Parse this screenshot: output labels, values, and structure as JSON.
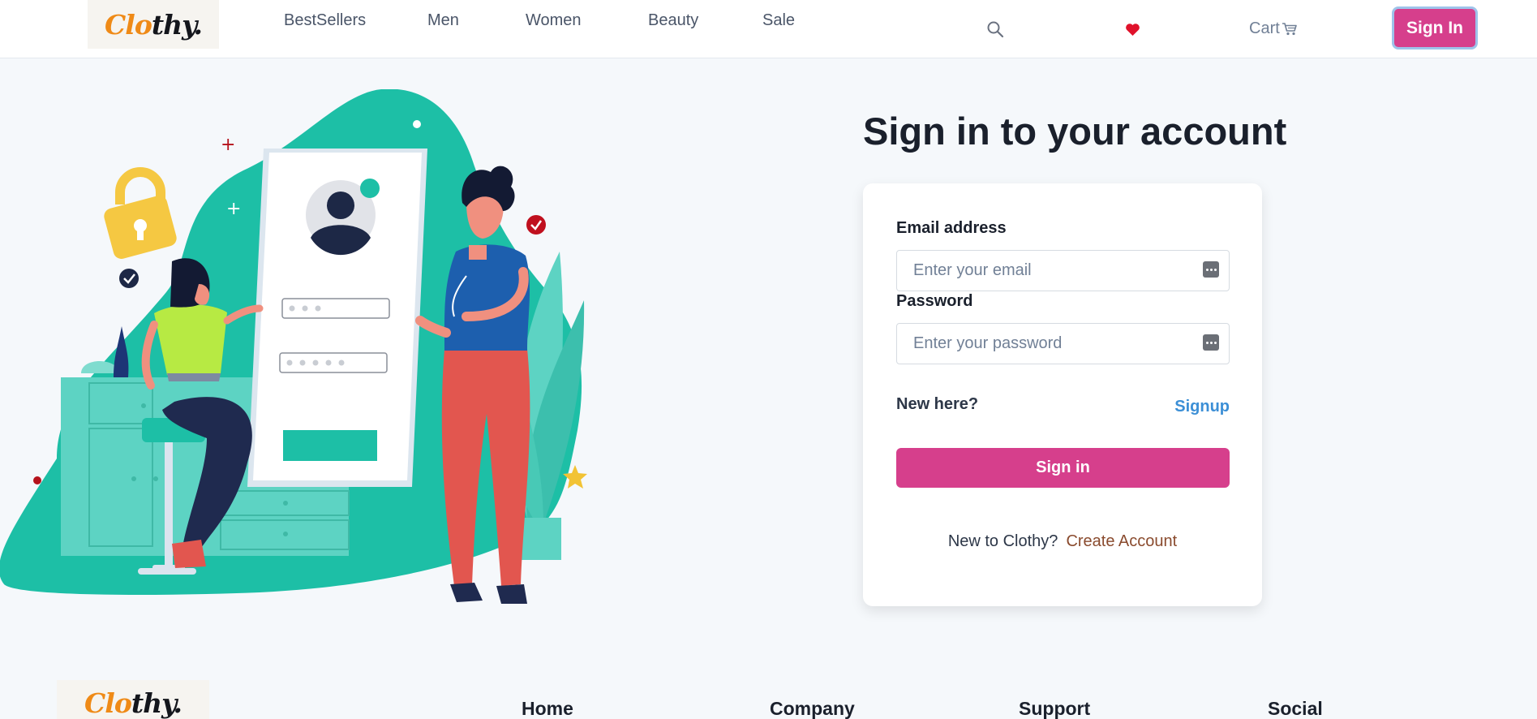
{
  "nav": {
    "logo_part1": "Clo",
    "logo_part2": "thy.",
    "links": [
      "BestSellers",
      "Men",
      "Women",
      "Beauty",
      "Sale"
    ],
    "cart_label": "Cart",
    "signin_label": "Sign In",
    "icons": {
      "search": "search-icon",
      "favorites": "heart-icon",
      "cart": "cart-icon"
    }
  },
  "form": {
    "heading": "Sign in to your account",
    "email_label": "Email address",
    "email_placeholder": "Enter your email",
    "password_label": "Password",
    "password_placeholder": "Enter your password",
    "new_here_text": "New here?",
    "signup_link": "Signup",
    "signin_button": "Sign in",
    "new_to_text": "New to Clothy?",
    "create_account_link": "Create Account"
  },
  "footer": {
    "logo_part1": "Clo",
    "logo_part2": "thy.",
    "columns": [
      "Home",
      "Company",
      "Support",
      "Social"
    ]
  },
  "colors": {
    "brand_orange": "#ef8a17",
    "primary_pink": "#d63f8c",
    "link_blue": "#3c8fd6",
    "illustration_teal": "#1dbfa6",
    "heart_red": "#e0122b"
  }
}
